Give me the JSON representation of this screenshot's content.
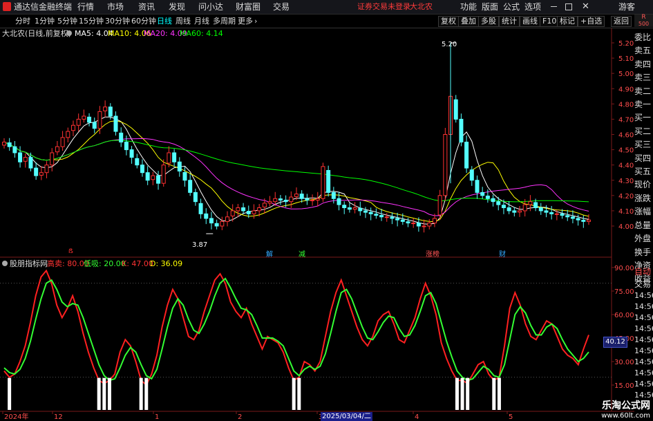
{
  "titlebar": {
    "app_title": "通达信金融终端",
    "menus": [
      "行情",
      "市场",
      "资讯",
      "发现",
      "问小达",
      "财富圈",
      "交易"
    ],
    "warning": "证券交易未登录",
    "stock": "大北农",
    "right_menus": [
      "功能",
      "版面",
      "公式",
      "选项"
    ],
    "guest": "游客"
  },
  "toolbar": {
    "periods": [
      "分时",
      "1分钟",
      "5分钟",
      "15分钟",
      "30分钟",
      "60分钟",
      "日线",
      "周线",
      "月线",
      "多周期",
      "更多"
    ],
    "active_period": "日线",
    "right_buttons": [
      "复权",
      "叠加",
      "多股",
      "统计",
      "画线",
      "F10",
      "标记",
      "+自选",
      "返回"
    ]
  },
  "main_chart": {
    "title": "大北农(日线,前复权)",
    "ma": [
      {
        "label": "MA5: 4.04",
        "color": "#ffffff"
      },
      {
        "label": "MA10: 4.06",
        "color": "#ffff00"
      },
      {
        "label": "MA20: 4.09",
        "color": "#ff33ff"
      },
      {
        "label": "MA60: 4.14",
        "color": "#00ff00"
      }
    ],
    "price_axis": [
      "5.20",
      "5.10",
      "5.00",
      "4.90",
      "4.80",
      "4.70",
      "4.60",
      "4.50",
      "4.40",
      "4.30",
      "4.20",
      "4.10",
      "4.00"
    ],
    "high_label": "5.20",
    "low_label": "3.87",
    "event_tags": [
      "解",
      "减",
      "涨榜",
      "财"
    ],
    "corner_label": "R",
    "corner_sub": "500"
  },
  "indicator": {
    "title": "股朋指标网",
    "params": [
      {
        "label": "高卖: 80.00",
        "color": "#ff3333"
      },
      {
        "label": "低吸: 20.00",
        "color": "#33ff33"
      },
      {
        "label": "K: 47.00",
        "color": "#ff3333"
      },
      {
        "label": "D: 36.09",
        "color": "#ffff00"
      }
    ],
    "axis": [
      "90.00",
      "75.00",
      "60.00",
      "45.00",
      "30.00",
      "15.00"
    ],
    "current_value": "40.12"
  },
  "date_axis": {
    "labels": [
      "2024年",
      "12",
      "1",
      "2",
      "3",
      "4",
      "5"
    ],
    "cursor_date": "2025/03/04/二"
  },
  "side_panel": {
    "items": [
      "委比",
      "卖五",
      "卖四",
      "卖三",
      "卖二",
      "卖一",
      "买一",
      "买二",
      "买三",
      "买四",
      "买五",
      "现价",
      "涨跌",
      "涨幅",
      "总量",
      "外盘",
      "换手",
      "净资",
      "收益"
    ],
    "lower_items": [
      "自动",
      "交易",
      "14:56",
      "14:56",
      "14:56",
      "14:56",
      "14:56",
      "14:56",
      "14:56",
      "14:56",
      "14:56",
      "14:56"
    ]
  },
  "watermark": {
    "title": "乐淘公式网",
    "url": "www.60lt.com"
  },
  "chart_data": [
    {
      "type": "candlestick",
      "title": "大北农(日线,前复权)",
      "ylim": [
        3.87,
        5.2
      ],
      "series": [
        {
          "name": "close",
          "values": [
            4.55,
            4.52,
            4.48,
            4.42,
            4.45,
            4.38,
            4.33,
            4.35,
            4.4,
            4.48,
            4.52,
            4.58,
            4.62,
            4.66,
            4.7,
            4.72,
            4.68,
            4.64,
            4.75,
            4.78,
            4.72,
            4.62,
            4.55,
            4.5,
            4.45,
            4.4,
            4.35,
            4.3,
            4.33,
            4.28,
            4.4,
            4.48,
            4.42,
            4.36,
            4.3,
            4.22,
            4.16,
            4.08,
            4.05,
            4.02,
            4.0,
            4.03,
            4.06,
            4.1,
            4.12,
            4.1,
            4.08,
            4.1,
            4.12,
            4.15,
            4.16,
            4.18,
            4.17,
            4.16,
            4.19,
            4.21,
            4.18,
            4.17,
            4.17,
            4.18,
            4.39,
            4.22,
            4.18,
            4.14,
            4.12,
            4.11,
            4.12,
            4.1,
            4.09,
            4.08,
            4.07,
            4.06,
            4.06,
            4.05,
            4.04,
            4.03,
            4.02,
            4.02,
            4.0,
            4.0,
            4.02,
            4.05,
            4.2,
            4.6,
            4.85,
            4.7,
            4.55,
            4.38,
            4.3,
            4.22,
            4.2,
            4.18,
            4.16,
            4.14,
            4.12,
            4.1,
            4.09,
            4.1,
            4.14,
            4.16,
            4.12,
            4.1,
            4.09,
            4.08,
            4.08,
            4.07,
            4.06,
            4.05,
            4.04,
            4.03,
            4.04
          ]
        },
        {
          "name": "MA5",
          "values": [
            4.04
          ]
        },
        {
          "name": "MA10",
          "values": [
            4.06
          ]
        },
        {
          "name": "MA20",
          "values": [
            4.09
          ]
        },
        {
          "name": "MA60",
          "values": [
            4.14
          ]
        }
      ]
    },
    {
      "type": "line",
      "title": "股朋指标网",
      "ylim": [
        10,
        92
      ],
      "series": [
        {
          "name": "K",
          "values": [
            24,
            20,
            22,
            30,
            40,
            55,
            72,
            84,
            88,
            80,
            66,
            58,
            64,
            72,
            62,
            48,
            36,
            26,
            18,
            16,
            18,
            22,
            36,
            44,
            40,
            30,
            18,
            15,
            22,
            34,
            52,
            66,
            76,
            70,
            58,
            46,
            44,
            50,
            62,
            72,
            82,
            86,
            80,
            68,
            62,
            58,
            64,
            54,
            46,
            38,
            46,
            44,
            42,
            36,
            26,
            18,
            20,
            30,
            28,
            24,
            30,
            46,
            62,
            74,
            82,
            72,
            62,
            52,
            44,
            40,
            46,
            56,
            60,
            62,
            54,
            44,
            42,
            50,
            58,
            70,
            80,
            72,
            60,
            42,
            32,
            24,
            18,
            18,
            16,
            22,
            28,
            30,
            22,
            18,
            20,
            40,
            64,
            74,
            66,
            54,
            46,
            44,
            50,
            56,
            54,
            46,
            38,
            34,
            32,
            28,
            38,
            47
          ]
        },
        {
          "name": "D",
          "values": [
            26,
            23,
            22,
            25,
            32,
            43,
            57,
            70,
            80,
            82,
            76,
            68,
            65,
            67,
            66,
            58,
            48,
            38,
            28,
            21,
            18,
            19,
            26,
            34,
            39,
            36,
            28,
            21,
            19,
            25,
            38,
            52,
            64,
            70,
            66,
            57,
            50,
            48,
            54,
            62,
            72,
            80,
            83,
            77,
            70,
            64,
            63,
            60,
            53,
            45,
            45,
            45,
            43,
            40,
            32,
            24,
            21,
            25,
            27,
            25,
            27,
            35,
            48,
            62,
            74,
            76,
            70,
            61,
            52,
            45,
            44,
            49,
            55,
            59,
            58,
            51,
            46,
            47,
            53,
            62,
            72,
            74,
            67,
            55,
            43,
            33,
            24,
            20,
            18,
            19,
            23,
            27,
            25,
            21,
            20,
            28,
            44,
            60,
            65,
            61,
            53,
            47,
            47,
            52,
            54,
            51,
            44,
            38,
            34,
            30,
            32,
            36.09
          ]
        }
      ]
    }
  ]
}
